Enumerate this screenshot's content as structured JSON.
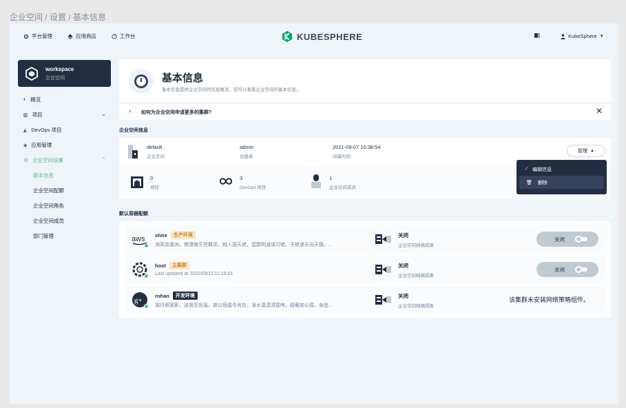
{
  "breadcrumb": "企业空间 / 设置 / 基本信息",
  "topnav": {
    "platform": "平台管理",
    "appstore": "应用商店",
    "workbench": "工作台",
    "logo": "KUBESPHERE",
    "user": "KubeSphere"
  },
  "sidebar": {
    "ws_name": "workspace",
    "ws_sub": "企业空间",
    "items": [
      {
        "label": "概览"
      },
      {
        "label": "项目"
      },
      {
        "label": "DevOps 项目"
      },
      {
        "label": "应用管理"
      },
      {
        "label": "企业空间设置"
      }
    ],
    "sub_items": [
      "基本信息",
      "企业空间配额",
      "企业空间角色",
      "企业空间成员",
      "部门管理"
    ]
  },
  "header": {
    "title": "基本信息",
    "desc": "基本信息提供企业空间的信息概览。您可以查看企业空间的基本信息。"
  },
  "tip": {
    "text": "如何为企业空间申请更多的集群?"
  },
  "info_section": "企业空间信息",
  "info": {
    "name": "default",
    "name_label": "企业空间",
    "creator": "admin",
    "creator_label": "创建者",
    "created": "2021-09-07 10:38:54",
    "created_label": "创建时间",
    "manage": "管理",
    "projects": "0",
    "projects_label": "项目",
    "devops": "3",
    "devops_label": "DevOps 项目",
    "members": "1",
    "members_label": "企业空间成员"
  },
  "dropdown": {
    "edit": "编辑信息",
    "delete": "删除"
  },
  "cluster_section": "默认容器配额",
  "clusters": [
    {
      "name": "shire",
      "tag": "生产环境",
      "desc": "海客談瀛洲，煙濤微茫信難求。越人語天姥，雲霞明滅或可睹。天姥連天向天橫，...",
      "np_state": "关闭",
      "np_label": "企业空间网络隔离",
      "toggle": "关闭"
    },
    {
      "name": "host",
      "tag": "主集群",
      "desc": "Last updated at 2022/03/11 11:15:01",
      "np_state": "关闭",
      "np_label": "企业空间网络隔离",
      "toggle": "关闭"
    },
    {
      "name": "rohan",
      "tag": "开发环境",
      "desc": "湖月照我影，送我至剡溪。謝公宿處今尚在，淥水蕩漾清猿啼。腳著謝公屐，身登...",
      "np_state": "关闭",
      "np_label": "企业空间网络隔离",
      "no_np": "该集群未安装网络策略组件。"
    }
  ],
  "colors": {
    "dark": "#242e42",
    "green": "#55bc8a",
    "bg": "#eff4f9"
  }
}
